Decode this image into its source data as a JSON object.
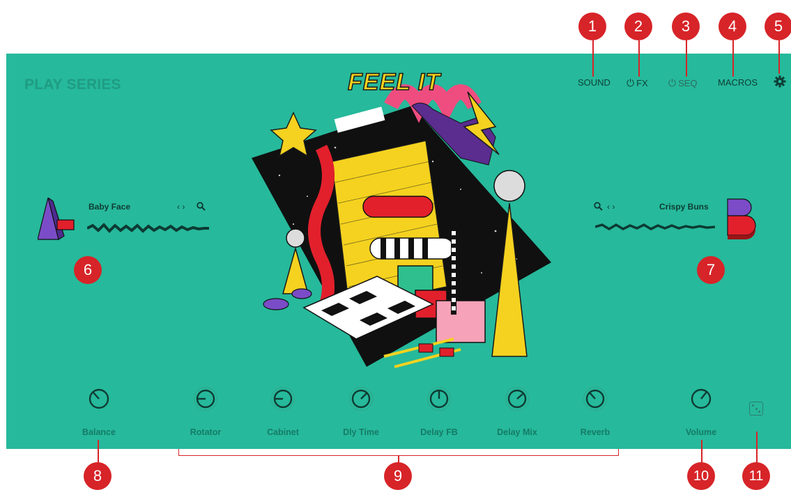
{
  "header": {
    "brand": "PLAY SERIES",
    "nav": {
      "sound": "SOUND",
      "fx": "FX",
      "seq": "SEQ",
      "macros": "MACROS"
    },
    "settings_icon": "gear-icon",
    "power_icon": "power-icon"
  },
  "artwork": {
    "logo": "FEEL IT"
  },
  "left_slot": {
    "name": "Baby Face",
    "browse_icons": "‹ › 🔍"
  },
  "right_slot": {
    "name": "Crispy Buns"
  },
  "knobs": [
    {
      "label": "Balance"
    },
    {
      "label": "Rotator"
    },
    {
      "label": "Cabinet"
    },
    {
      "label": "Dly Time"
    },
    {
      "label": "Delay FB"
    },
    {
      "label": "Delay Mix"
    },
    {
      "label": "Reverb"
    },
    {
      "label": "Volume"
    }
  ],
  "callouts": [
    "1",
    "2",
    "3",
    "4",
    "5",
    "6",
    "7",
    "8",
    "9",
    "10",
    "11"
  ],
  "colors": {
    "panel": "#26b99b",
    "callout": "#d72428",
    "label": "#157b66"
  }
}
